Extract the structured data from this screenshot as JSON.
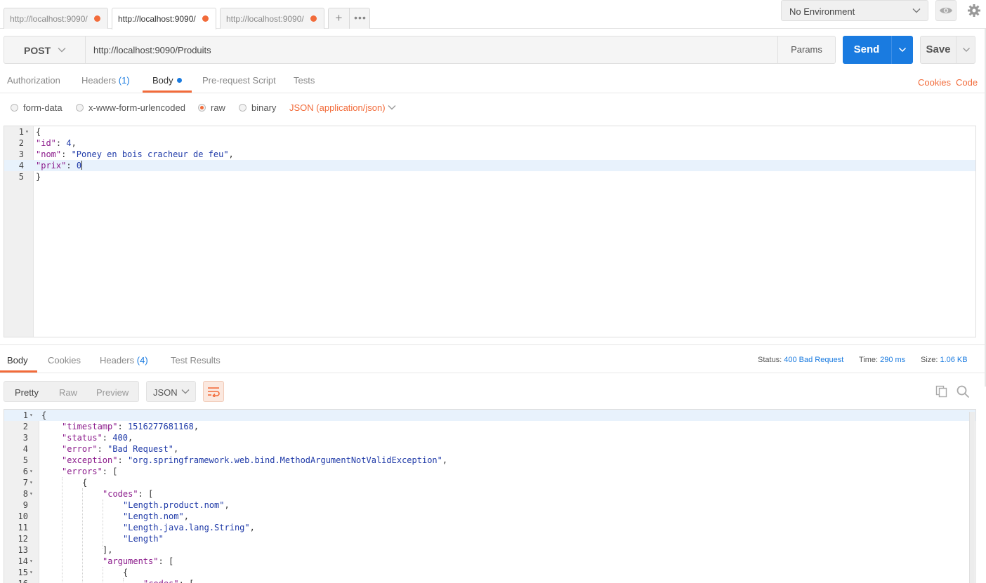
{
  "request_tabs": [
    {
      "title": "http://localhost:9090/",
      "active": false
    },
    {
      "title": "http://localhost:9090/",
      "active": true
    },
    {
      "title": "http://localhost:9090/",
      "active": false
    }
  ],
  "environment": {
    "selected": "No Environment"
  },
  "icons": {
    "eye": "eye-icon",
    "settings": "gear-icon",
    "plus": "plus-icon",
    "more": "ellipsis-icon",
    "wrap": "wrap-lines-icon",
    "copy": "copy-icon",
    "search": "search-icon"
  },
  "request": {
    "method": "POST",
    "url": "http://localhost:9090/Produits",
    "params_label": "Params",
    "send_label": "Send",
    "save_label": "Save"
  },
  "req_tabs": {
    "authorization": "Authorization",
    "headers": "Headers",
    "headers_count": "(1)",
    "body": "Body",
    "prerequest": "Pre-request Script",
    "tests": "Tests",
    "cookies": "Cookies",
    "code": "Code"
  },
  "body_modes": {
    "form_data": "form-data",
    "urlencoded": "x-www-form-urlencoded",
    "raw": "raw",
    "binary": "binary",
    "selected": "raw",
    "content_type": "JSON (application/json)"
  },
  "request_body": {
    "lines": [
      {
        "n": "1",
        "text": "{",
        "fold": true
      },
      {
        "n": "2",
        "key": "\"id\"",
        "num": "4",
        "tail": ","
      },
      {
        "n": "3",
        "key": "\"nom\"",
        "str": "\"Poney en bois cracheur de feu\"",
        "tail": ","
      },
      {
        "n": "4",
        "key": "\"prix\"",
        "num": "0",
        "cursor": true
      },
      {
        "n": "5",
        "text": "}"
      }
    ]
  },
  "response": {
    "tabs": {
      "body": "Body",
      "cookies": "Cookies",
      "headers": "Headers",
      "headers_count": "(4)",
      "test_results": "Test Results"
    },
    "status_label": "Status:",
    "status_value": "400 Bad Request",
    "time_label": "Time:",
    "time_value": "290 ms",
    "size_label": "Size:",
    "size_value": "1.06 KB",
    "formats": {
      "pretty": "Pretty",
      "raw": "Raw",
      "preview": "Preview",
      "language": "JSON"
    },
    "lines": [
      {
        "n": "1",
        "indent": 0,
        "text": "{",
        "fold": true,
        "cur": true
      },
      {
        "n": "2",
        "indent": 1,
        "key": "\"timestamp\"",
        "num": "1516277681168",
        "tail": ","
      },
      {
        "n": "3",
        "indent": 1,
        "key": "\"status\"",
        "num": "400",
        "tail": ","
      },
      {
        "n": "4",
        "indent": 1,
        "key": "\"error\"",
        "str": "\"Bad Request\"",
        "tail": ","
      },
      {
        "n": "5",
        "indent": 1,
        "key": "\"exception\"",
        "str": "\"org.springframework.web.bind.MethodArgumentNotValidException\"",
        "tail": ","
      },
      {
        "n": "6",
        "indent": 1,
        "key": "\"errors\"",
        "raw": "[",
        "fold": true
      },
      {
        "n": "7",
        "indent": 2,
        "text": "{",
        "fold": true
      },
      {
        "n": "8",
        "indent": 3,
        "key": "\"codes\"",
        "raw": "[",
        "fold": true
      },
      {
        "n": "9",
        "indent": 4,
        "str": "\"Length.product.nom\"",
        "tail": ","
      },
      {
        "n": "10",
        "indent": 4,
        "str": "\"Length.nom\"",
        "tail": ","
      },
      {
        "n": "11",
        "indent": 4,
        "str": "\"Length.java.lang.String\"",
        "tail": ","
      },
      {
        "n": "12",
        "indent": 4,
        "str": "\"Length\""
      },
      {
        "n": "13",
        "indent": 3,
        "text": "],"
      },
      {
        "n": "14",
        "indent": 3,
        "key": "\"arguments\"",
        "raw": "[",
        "fold": true
      },
      {
        "n": "15",
        "indent": 4,
        "text": "{",
        "fold": true
      },
      {
        "n": "16",
        "indent": 5,
        "key": "\"codes\"",
        "raw": "["
      }
    ]
  }
}
